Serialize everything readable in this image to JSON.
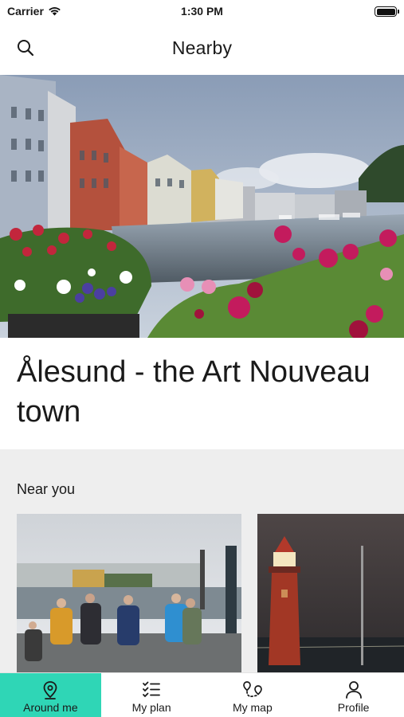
{
  "status_bar": {
    "carrier": "Carrier",
    "time": "1:30 PM",
    "battery_level": 1.0
  },
  "nav": {
    "title": "Nearby",
    "search_icon": "search-icon"
  },
  "hero": {
    "title": "Ålesund - the Art Nouveau town",
    "image": "alesund-canal-photo"
  },
  "near_you": {
    "heading": "Near you",
    "cards": [
      {
        "image": "tour-group-harbour-photo"
      },
      {
        "image": "lighthouse-night-photo"
      }
    ]
  },
  "tabs": [
    {
      "label": "Around me",
      "icon": "location-pin-icon",
      "active": true
    },
    {
      "label": "My plan",
      "icon": "checklist-icon",
      "active": false
    },
    {
      "label": "My map",
      "icon": "route-map-icon",
      "active": false
    },
    {
      "label": "Profile",
      "icon": "person-icon",
      "active": false
    }
  ],
  "colors": {
    "accent": "#2fd6b6",
    "section_bg": "#eeeeee",
    "text": "#1a1a1a"
  }
}
